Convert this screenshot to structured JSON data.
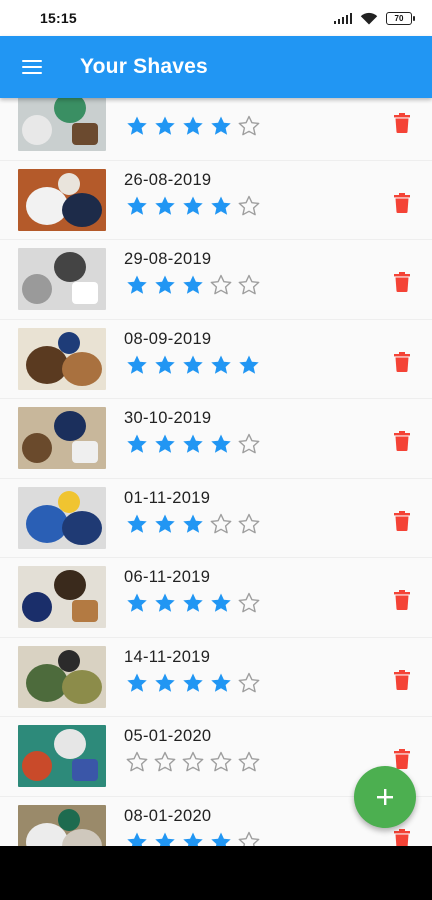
{
  "status_bar": {
    "time": "15:15",
    "battery_level": "70",
    "icons": [
      "signal-icon",
      "wifi-icon",
      "battery-icon"
    ]
  },
  "app_bar": {
    "title": "Your Shaves",
    "menu_icon": "menu-icon",
    "color": "#2196f3"
  },
  "shaves": [
    {
      "date": "",
      "rating": 4,
      "partially_visible": true,
      "thumb": [
        "#c9cfcf",
        "#3a8f63",
        "#e8e8e8",
        "#6b4a2f"
      ]
    },
    {
      "date": "26-08-2019",
      "rating": 4,
      "thumb": [
        "#1d2b49",
        "#e9e4dc",
        "#b45a2a",
        "#f2f2f2"
      ]
    },
    {
      "date": "29-08-2019",
      "rating": 3,
      "thumb": [
        "#d9d9d9",
        "#444444",
        "#9a9a9a",
        "#ffffff"
      ]
    },
    {
      "date": "08-09-2019",
      "rating": 5,
      "thumb": [
        "#a9713f",
        "#1e3c78",
        "#e9e2d3",
        "#5a3a20"
      ]
    },
    {
      "date": "30-10-2019",
      "rating": 4,
      "thumb": [
        "#c8b79b",
        "#1b2f5c",
        "#6a4a2c",
        "#efefef"
      ]
    },
    {
      "date": "01-11-2019",
      "rating": 3,
      "thumb": [
        "#1f3a74",
        "#f0c430",
        "#dcdcdc",
        "#2a5fb5"
      ]
    },
    {
      "date": "06-11-2019",
      "rating": 4,
      "thumb": [
        "#e3dfd6",
        "#3a2a1c",
        "#1a2e6a",
        "#b37a42"
      ]
    },
    {
      "date": "14-11-2019",
      "rating": 4,
      "thumb": [
        "#8c8c4a",
        "#2b2b2b",
        "#d9d2c2",
        "#4d6b3c"
      ]
    },
    {
      "date": "05-01-2020",
      "rating": 0,
      "thumb": [
        "#2d8a7a",
        "#e6e6e6",
        "#c94a2a",
        "#3a56a8"
      ]
    },
    {
      "date": "08-01-2020",
      "rating": 4,
      "thumb": [
        "#cfc8bd",
        "#1e6b4f",
        "#9a8a6a",
        "#ececec"
      ]
    }
  ],
  "max_rating": 5,
  "colors": {
    "star_filled": "#2196f3",
    "star_empty": "#9e9e9e",
    "delete": "#f44336",
    "fab": "#4caf50"
  },
  "fab": {
    "icon": "plus-icon",
    "label": "+"
  },
  "delete_icon": "trash-icon"
}
